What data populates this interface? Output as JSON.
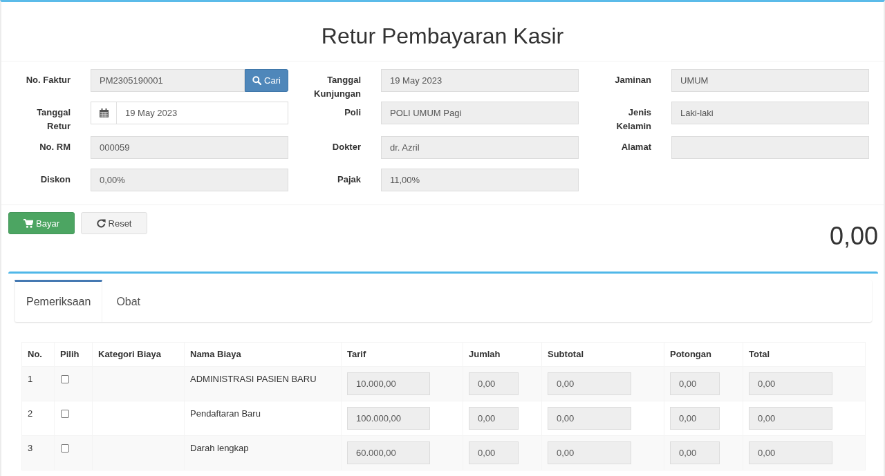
{
  "page": {
    "title": "Retur Pembayaran Kasir"
  },
  "form": {
    "columns": [
      [
        {
          "label": "No. Faktur",
          "value": "PM2305190001",
          "kind": "search",
          "readonly": true,
          "button": "Cari"
        },
        {
          "label": "Tanggal Retur",
          "value": "19 May 2023",
          "kind": "date",
          "readonly": false
        },
        {
          "label": "No. RM",
          "value": "000059",
          "kind": "text",
          "readonly": true
        },
        {
          "label": "Diskon",
          "value": "0,00%",
          "kind": "text",
          "readonly": true
        }
      ],
      [
        {
          "label": "Tanggal Kunjungan",
          "value": "19 May 2023",
          "kind": "text",
          "readonly": true
        },
        {
          "label": "Poli",
          "value": "POLI UMUM Pagi",
          "kind": "text",
          "readonly": true
        },
        {
          "label": "Dokter",
          "value": "dr. Azril",
          "kind": "text",
          "readonly": true
        },
        {
          "label": "Pajak",
          "value": "11,00%",
          "kind": "text",
          "readonly": true
        }
      ],
      [
        {
          "label": "Jaminan",
          "value": "UMUM",
          "kind": "text",
          "readonly": true
        },
        {
          "label": "Jenis Kelamin",
          "value": "Laki-laki",
          "kind": "text",
          "readonly": true
        },
        {
          "label": "Alamat",
          "kind": "text",
          "readonly": true
        }
      ]
    ]
  },
  "actions": [
    {
      "label": "Bayar",
      "kind": "success"
    },
    {
      "label": "Reset",
      "kind": "default"
    }
  ],
  "total": "0,00",
  "tabs": [
    {
      "label": "Pemeriksaan",
      "selected": true
    },
    {
      "label": "Obat",
      "selected": false
    }
  ],
  "table": {
    "columns": [
      "No.",
      "Pilih",
      "Kategori Biaya",
      "Nama Biaya",
      "Tarif",
      "Jumlah",
      "Subtotal",
      "Potongan",
      "Total"
    ],
    "fields_readonly": true,
    "rows": [
      {
        "no": "1",
        "checked": false,
        "name": "ADMINISTRASI PASIEN BARU",
        "tarif": "10.000,00",
        "jumlah": "0,00",
        "subtotal": "0,00",
        "potongan": "0,00",
        "total": "0,00"
      },
      {
        "no": "2",
        "checked": false,
        "name": "Pendaftaran Baru",
        "tarif": "100.000,00",
        "jumlah": "0,00",
        "subtotal": "0,00",
        "potongan": "0,00",
        "total": "0,00"
      },
      {
        "no": "3",
        "checked": false,
        "name": "Darah lengkap",
        "tarif": "60.000,00",
        "jumlah": "0,00",
        "subtotal": "0,00",
        "potongan": "0,00",
        "total": "0,00"
      }
    ]
  }
}
